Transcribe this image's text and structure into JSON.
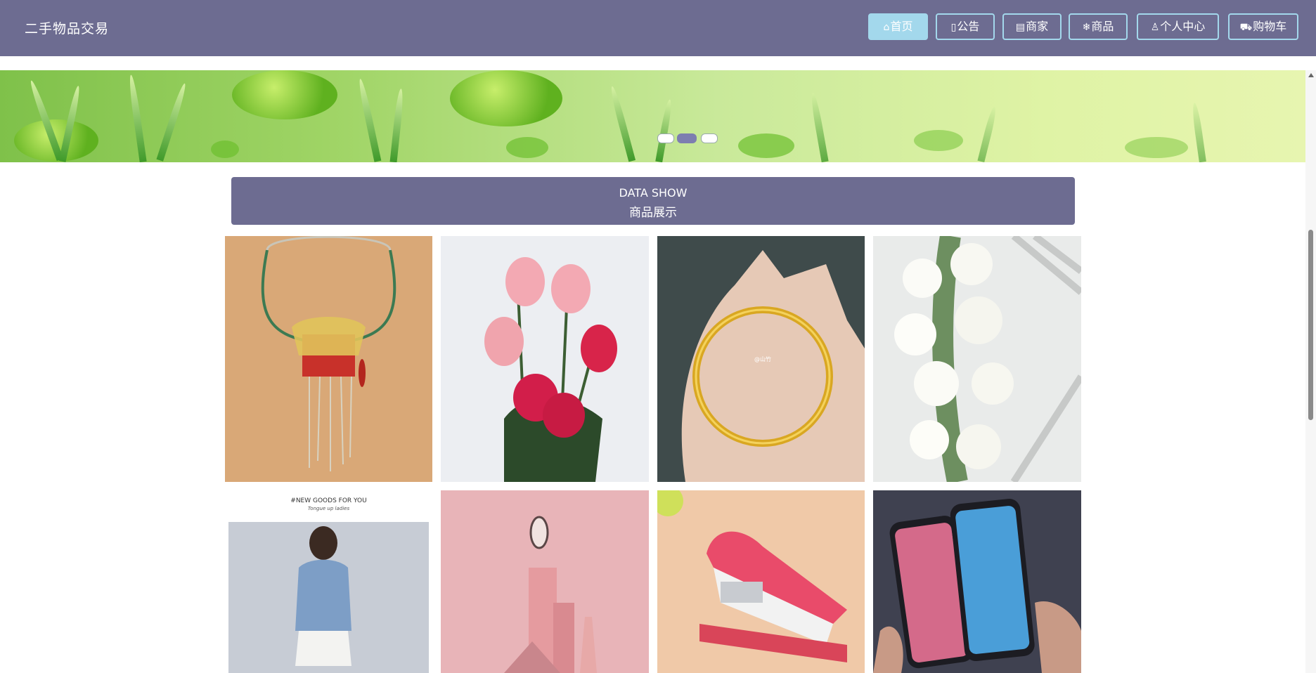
{
  "header": {
    "brand": "二手物品交易",
    "nav": [
      {
        "icon": "home-icon",
        "glyph": "⌂",
        "label": "首页",
        "active": true
      },
      {
        "icon": "notice-icon",
        "glyph": "▯",
        "label": "公告",
        "active": false
      },
      {
        "icon": "shop-icon",
        "glyph": "▤",
        "label": "商家",
        "active": false
      },
      {
        "icon": "goods-icon",
        "glyph": "❄",
        "label": "商品",
        "active": false
      },
      {
        "icon": "user-icon",
        "glyph": "♙",
        "label": "个人中心",
        "active": false
      },
      {
        "icon": "cart-icon",
        "glyph": "⛟",
        "label": "购物车",
        "active": false
      }
    ]
  },
  "banner": {
    "slides": 3,
    "active_slide": 2
  },
  "section": {
    "title_en": "DATA SHOW",
    "title_zh": "商品展示"
  },
  "products": [
    {
      "name": "necklace-image"
    },
    {
      "name": "roses-image"
    },
    {
      "name": "gold-bangle-image",
      "watermark": "@山竹"
    },
    {
      "name": "white-flowers-image"
    },
    {
      "name": "clothing-image",
      "overlay_title": "#NEW GOODS FOR YOU",
      "overlay_sub": "Tongue up ladies"
    },
    {
      "name": "cosmetics-image"
    },
    {
      "name": "stapler-image"
    },
    {
      "name": "phones-image"
    }
  ],
  "colors": {
    "header_bg": "#6d6c91",
    "nav_border": "#a3d8ec",
    "nav_active_bg": "#a3d8ec"
  }
}
